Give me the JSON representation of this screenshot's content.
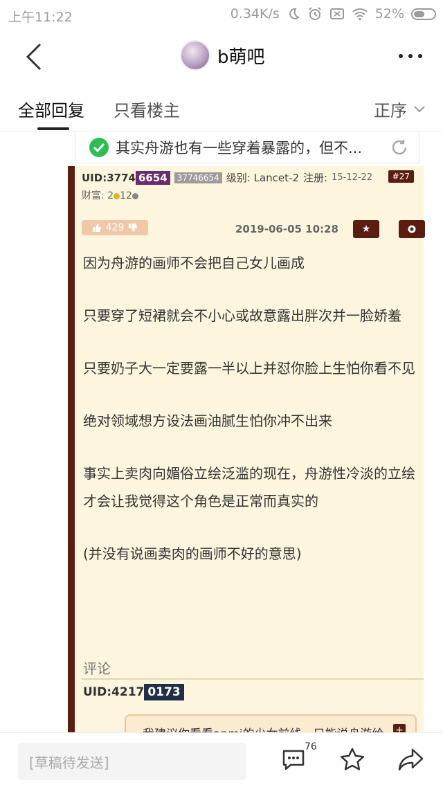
{
  "status_bar": {
    "time": "上午11:22",
    "speed": "0.34K/s",
    "battery": "52%"
  },
  "header": {
    "title": "b萌吧"
  },
  "tabs": {
    "all_replies": "全部回复",
    "op_only": "只看楼主",
    "sort": "正序"
  },
  "quote": {
    "text": "其实舟游也有一些穿着暴露的，但不..."
  },
  "post": {
    "uid_prefix": "UID:3774",
    "uid_highlight": "6654",
    "uid_full": "37746654",
    "level": "级别: Lancet-2",
    "reg_label": "注册:",
    "reg_date": "15-12-22",
    "floor": "#27",
    "wealth_label": "财富: 2",
    "wealth_gold": "12",
    "likes": "429",
    "date": "2019-06-05 10:28",
    "paragraphs": [
      "因为舟游的画师不会把自己女儿画成",
      "只要穿了短裙就会不小心或故意露出胖次并一脸娇羞",
      "只要奶子大一定要露一半以上并怼你脸上生怕你看不见",
      "绝对领域想方设法画油腻生怕你冲不出来",
      "事实上卖肉向媚俗立绘泛滥的现在，舟游性冷淡的立绘才会让我觉得这个角色是正常而真实的",
      "(并没有说画卖肉的画师不好的意思)"
    ],
    "comment_label": "评论",
    "comment_uid_prefix": "UID:4217",
    "comment_uid_highlight": "0173",
    "reply_text": "我建议你看看anmi的少女前线，只能说舟游给画师的要求是不能卖肉或者性冷淡，并不是"
  },
  "bottom_bar": {
    "draft_placeholder": "[草稿待发送]",
    "comment_count": "76"
  }
}
